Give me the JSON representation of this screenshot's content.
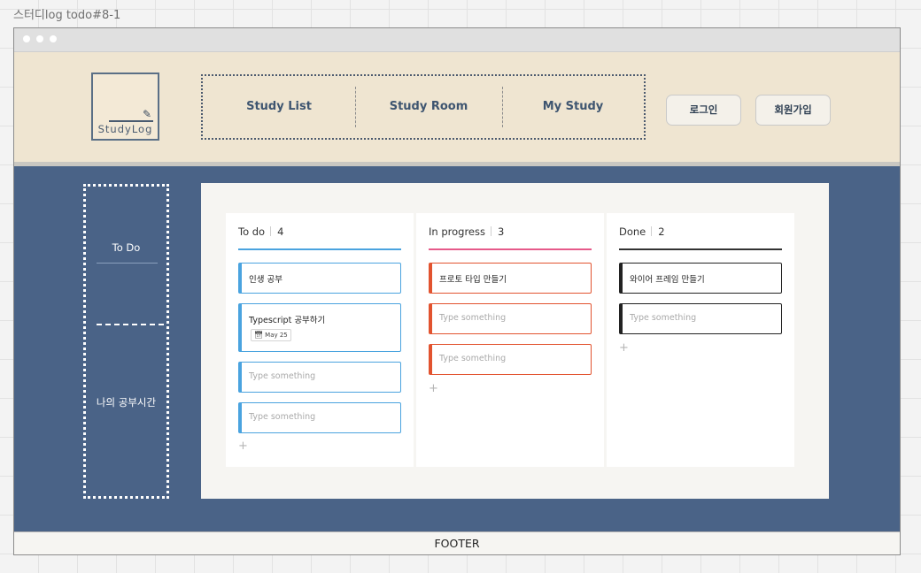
{
  "frame_title": "스터디log todo#8-1",
  "logo": {
    "text": "StudyLog",
    "pen": "✎"
  },
  "nav": [
    "Study List",
    "Study Room",
    "My Study"
  ],
  "auth": {
    "login": "로그인",
    "signup": "회원가입"
  },
  "sidebar": {
    "todo": "To Do",
    "study_time": "나의 공부시간"
  },
  "columns": [
    {
      "title": "To do",
      "count": "4",
      "accent": "#4aa3df",
      "cards": [
        {
          "title": "인생 공부"
        },
        {
          "title": "Typescript 공부하기",
          "date": "May 25"
        },
        {
          "placeholder": "Type something"
        },
        {
          "placeholder": "Type something"
        }
      ]
    },
    {
      "title": "In progress",
      "count": "3",
      "accent": "#e2532f",
      "cards": [
        {
          "title": "프로토 타입 만들기"
        },
        {
          "placeholder": "Type something"
        },
        {
          "placeholder": "Type something"
        }
      ]
    },
    {
      "title": "Done",
      "count": "2",
      "accent": "#222222",
      "cards": [
        {
          "title": "와이어 프레임 만들기"
        },
        {
          "placeholder": "Type something"
        }
      ]
    }
  ],
  "add_symbol": "+",
  "footer": "FOOTER"
}
